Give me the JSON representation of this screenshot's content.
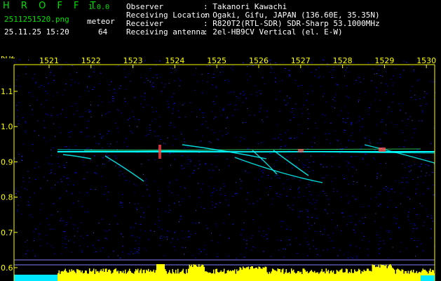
{
  "header": {
    "app_name": "H R O F F T",
    "version": "1.0.0",
    "filename": "2511251520.png",
    "datetime": "25.11.25 15:20",
    "meteor_label": "meteor",
    "meteor_count": "64",
    "info": [
      {
        "key": "Observer",
        "value": ": Takanori Kawachi"
      },
      {
        "key": "Receiving Location",
        "value": ": Ogaki, Gifu, JAPAN (136.60E, 35.35N)"
      },
      {
        "key": "Receiver",
        "value": ": R820T2(RTL-SDR) SDR-Sharp 53.1000MHz"
      },
      {
        "key": "Receiving antenna",
        "value": ": 2el-HB9CV Vertical (el. E-W)"
      }
    ]
  },
  "spectrogram": {
    "y_unit": "kHz",
    "y_ticks": [
      "1.1",
      "1.0",
      "0.9",
      "0.8",
      "0.7",
      "0.6"
    ],
    "x_ticks": [
      "1521",
      "1522",
      "1523",
      "1524",
      "1525",
      "1526",
      "1527",
      "1528",
      "1529",
      "1530"
    ],
    "colors": {
      "axis": "#ffff00",
      "noise": "#0000a0",
      "echo_line": "#00ffff",
      "level_bar": "#ffff00",
      "level_base": "#00e8ff"
    }
  }
}
